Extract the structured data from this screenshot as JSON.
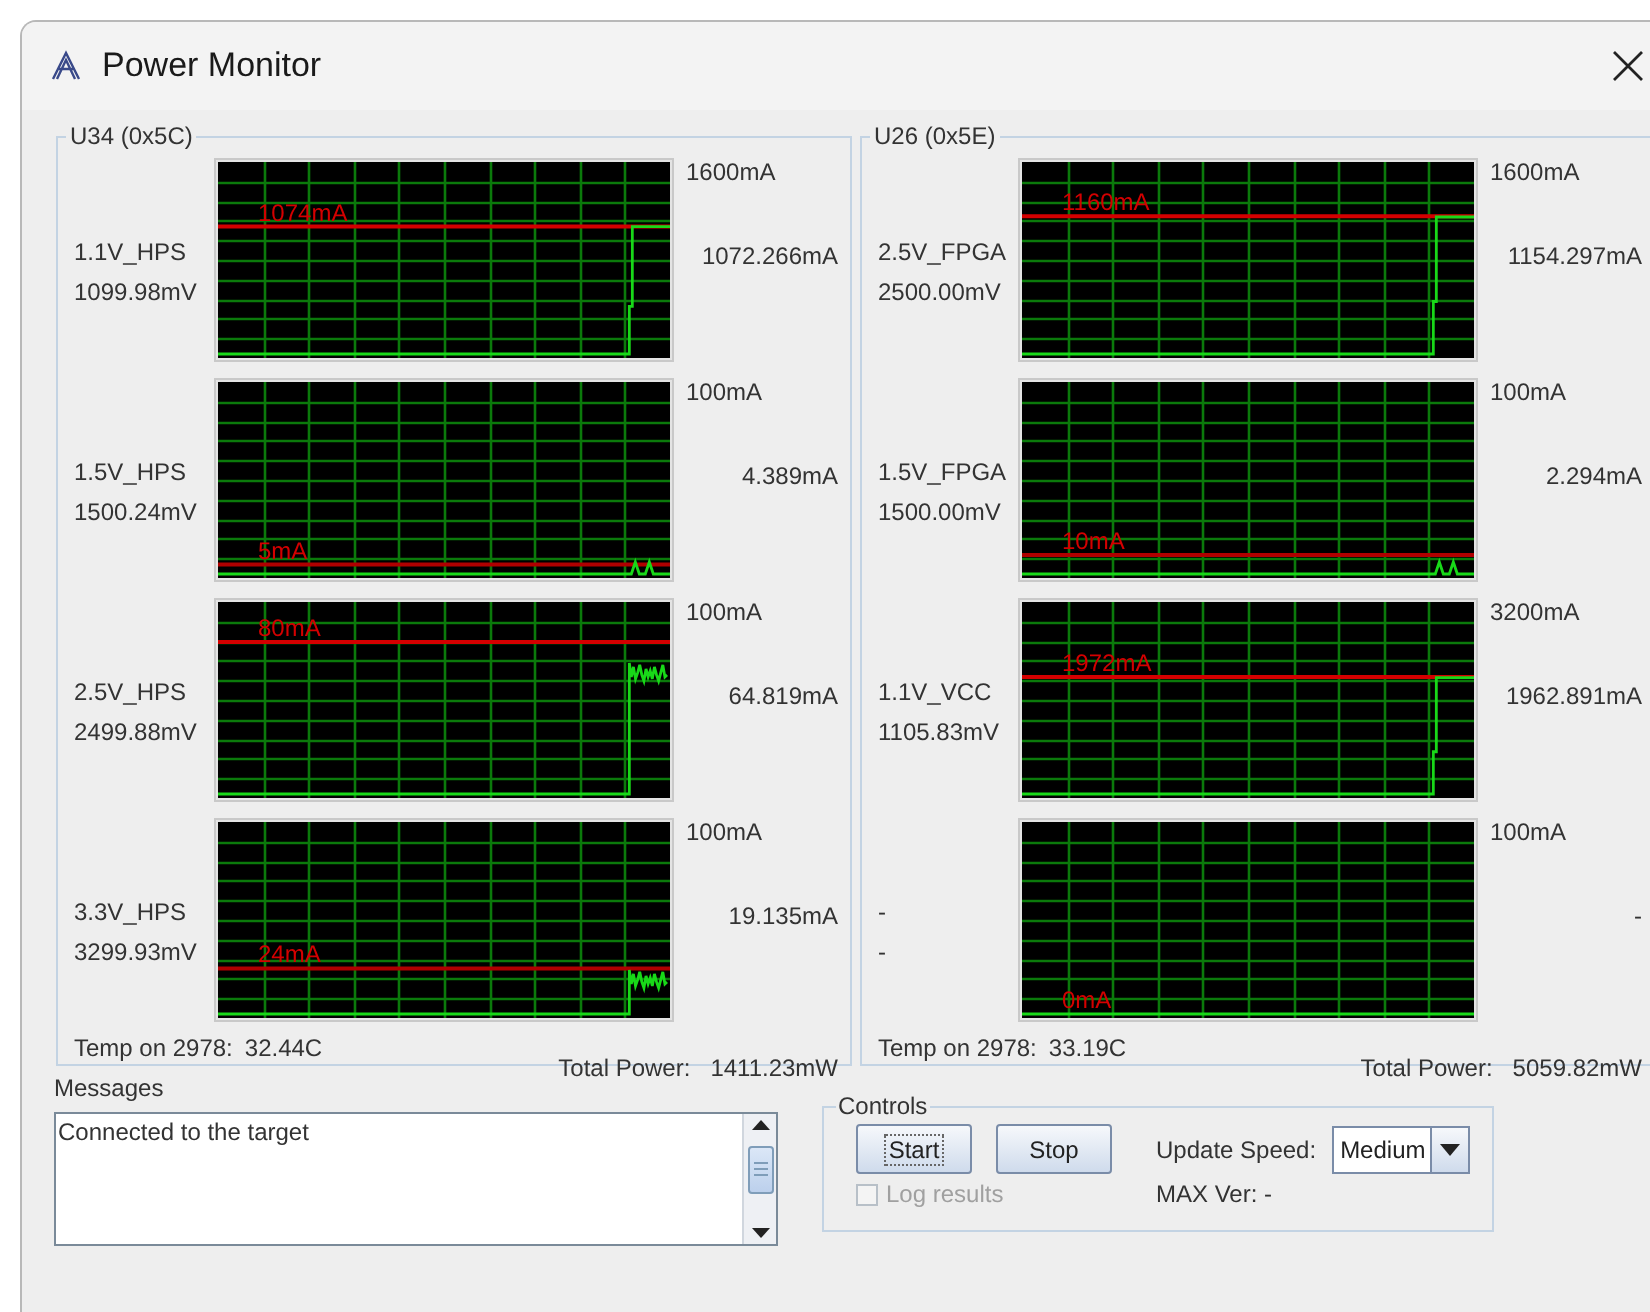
{
  "window": {
    "title": "Power Monitor"
  },
  "devices": [
    {
      "title": "U34 (0x5C)",
      "channels": [
        {
          "name": "1.1V_HPS",
          "voltage": "1099.98mV",
          "scale": "1600mA",
          "current": "1072.266mA",
          "limit": "1074mA"
        },
        {
          "name": "1.5V_HPS",
          "voltage": "1500.24mV",
          "scale": "100mA",
          "current": "4.389mA",
          "limit": "5mA"
        },
        {
          "name": "2.5V_HPS",
          "voltage": "2499.88mV",
          "scale": "100mA",
          "current": "64.819mA",
          "limit": "80mA"
        },
        {
          "name": "3.3V_HPS",
          "voltage": "3299.93mV",
          "scale": "100mA",
          "current": "19.135mA",
          "limit": "24mA"
        }
      ],
      "temperature": {
        "label": "Temp on 2978:",
        "value": "32.44C"
      },
      "total_power": {
        "label": "Total Power:",
        "value": "1411.23mW"
      }
    },
    {
      "title": "U26 (0x5E)",
      "channels": [
        {
          "name": "2.5V_FPGA",
          "voltage": "2500.00mV",
          "scale": "1600mA",
          "current": "1154.297mA",
          "limit": "1160mA"
        },
        {
          "name": "1.5V_FPGA",
          "voltage": "1500.00mV",
          "scale": "100mA",
          "current": "2.294mA",
          "limit": "10mA"
        },
        {
          "name": "1.1V_VCC",
          "voltage": "1105.83mV",
          "scale": "3200mA",
          "current": "1962.891mA",
          "limit": "1972mA"
        },
        {
          "name": "-",
          "voltage": "-",
          "scale": "100mA",
          "current": "-",
          "limit": "0mA"
        }
      ],
      "temperature": {
        "label": "Temp on 2978:",
        "value": "33.19C"
      },
      "total_power": {
        "label": "Total Power:",
        "value": "5059.82mW"
      }
    }
  ],
  "messages": {
    "title": "Messages",
    "lines": [
      "Connected to the target"
    ]
  },
  "controls": {
    "title": "Controls",
    "buttons": [
      {
        "label": "Start",
        "focused": true
      },
      {
        "label": "Stop",
        "focused": false
      }
    ],
    "update_speed": {
      "label": "Update Speed:",
      "value": "Medium"
    },
    "log_results": {
      "label": "Log results",
      "checked": false,
      "disabled": true
    },
    "max_ver": "MAX Ver: -"
  }
}
